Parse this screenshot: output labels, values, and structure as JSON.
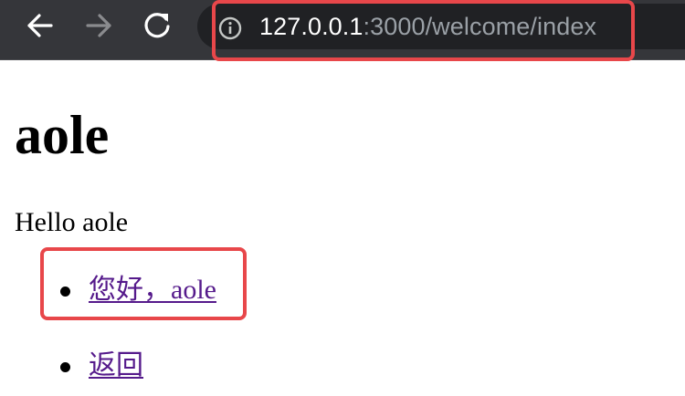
{
  "browser": {
    "url_host": "127.0.0.1",
    "url_path": ":3000/welcome/index",
    "nav_icons": [
      "back-arrow-icon",
      "forward-arrow-icon",
      "reload-icon",
      "info-icon"
    ],
    "colors": {
      "toolbar": "#35363a",
      "omnibox": "#202124",
      "url_host": "#ffffff",
      "url_path": "#9aa0a6",
      "highlight": "#e8474a"
    }
  },
  "page": {
    "heading": "aole",
    "greeting": "Hello aole",
    "links": [
      {
        "label": "您好，aole"
      },
      {
        "label": "返回"
      }
    ],
    "colors": {
      "text": "#000000",
      "visited_link": "#551a8b"
    }
  }
}
